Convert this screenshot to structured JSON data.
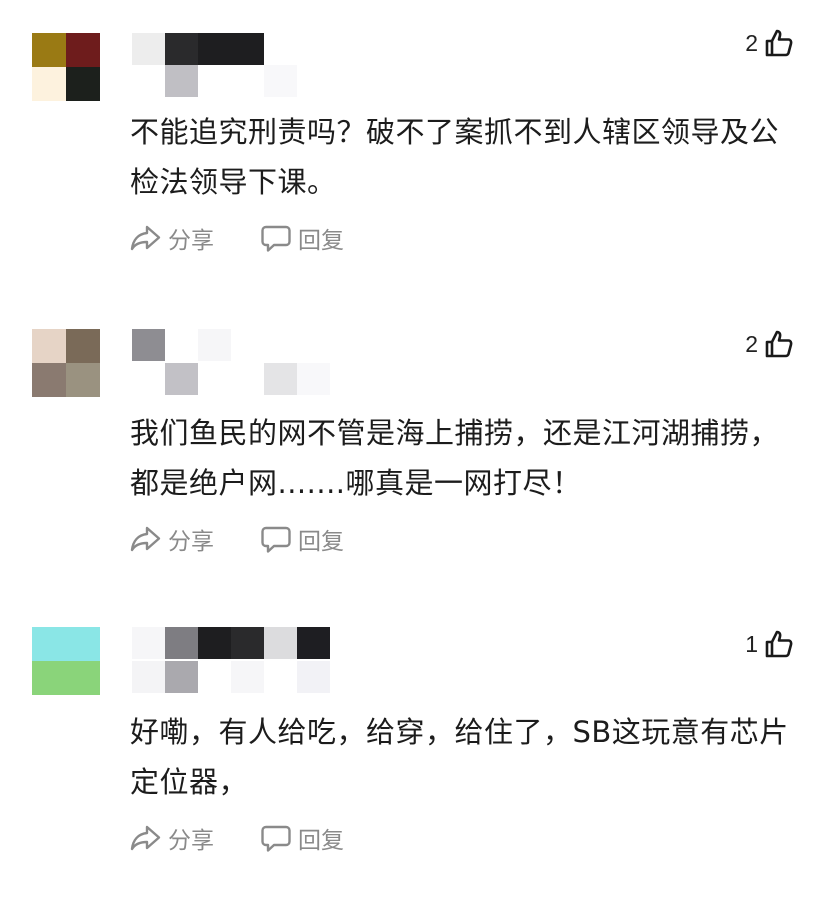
{
  "comments": [
    {
      "likes": "2",
      "text": "不能追究刑责吗？破不了案抓不到人辖区领导及公检法领导下课。",
      "share_label": "分享",
      "reply_label": "回复",
      "avatar_colors": [
        "#9a7a14",
        "#6e1c1c",
        "#fdf2de",
        "#1c201c"
      ]
    },
    {
      "likes": "2",
      "text": "我们鱼民的网不管是海上捕捞，还是江河湖捕捞，都是绝户网.......哪真是一网打尽！",
      "share_label": "分享",
      "reply_label": "回复",
      "avatar_colors": [
        "#e6d4c6",
        "#7a6a58",
        "#8a7a70",
        "#9a9280"
      ]
    },
    {
      "likes": "1",
      "text": "好嘞，有人给吃，给穿，给住了，SB这玩意有芯片定位器，",
      "share_label": "分享",
      "reply_label": "回复",
      "avatar_colors": [
        "#8ae6e6",
        "#8ae6e6",
        "#8ad47a",
        "#8ad47a"
      ]
    }
  ],
  "icons": {
    "like": "thumbs-up-icon",
    "share": "share-arrow-icon",
    "reply": "speech-bubble-icon"
  },
  "colors": {
    "text": "#1c1c1c",
    "action_text": "#8a8a8a",
    "background": "#ffffff"
  }
}
